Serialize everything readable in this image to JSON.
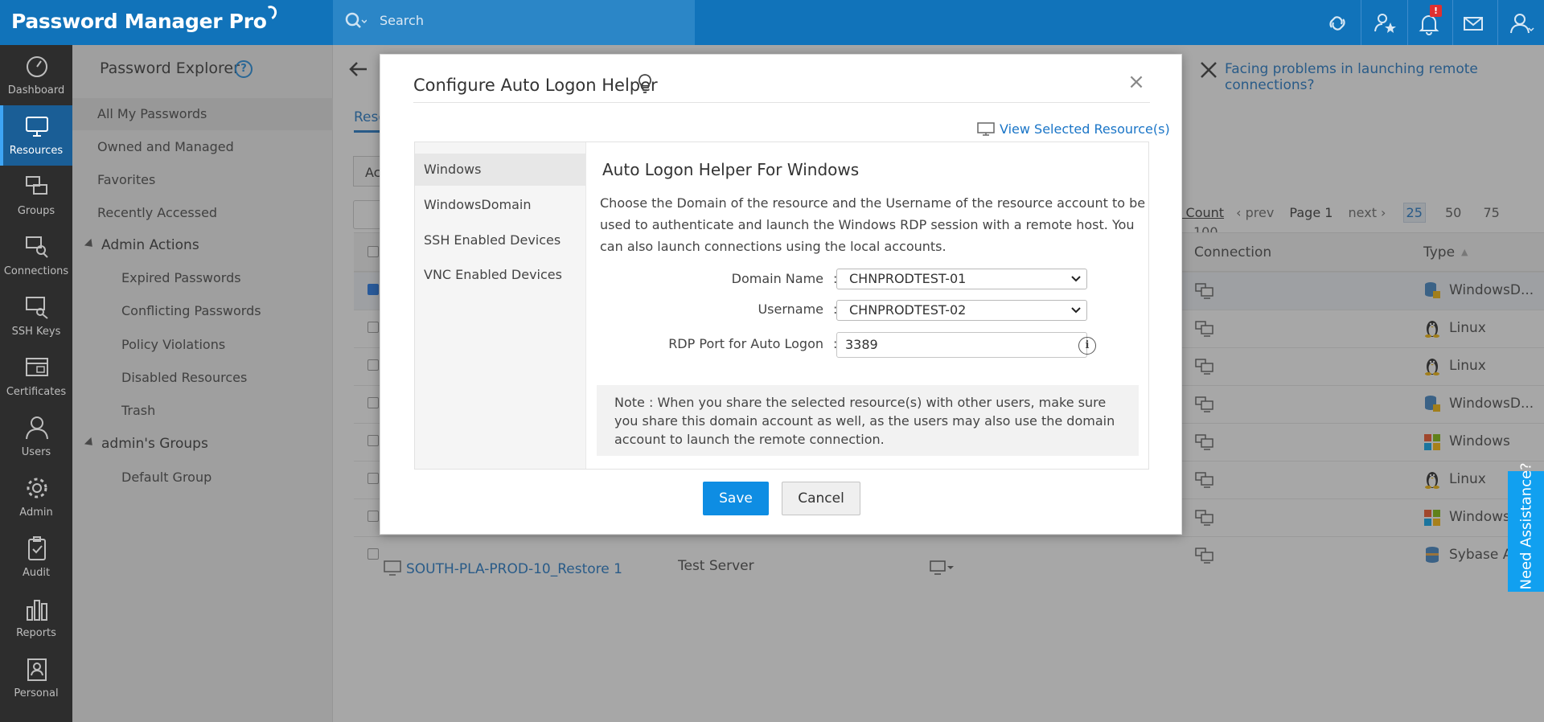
{
  "app": {
    "title": "Password Manager Pro",
    "search_placeholder": "Search",
    "notification_count": "!"
  },
  "leftnav": {
    "items": [
      {
        "label": "Dashboard",
        "icon": "dashboard-icon"
      },
      {
        "label": "Resources",
        "icon": "monitor-icon",
        "active": true
      },
      {
        "label": "Groups",
        "icon": "groups-icon"
      },
      {
        "label": "Connections",
        "icon": "connections-icon"
      },
      {
        "label": "SSH Keys",
        "icon": "ssh-key-icon"
      },
      {
        "label": "Certificates",
        "icon": "certificate-icon"
      },
      {
        "label": "Users",
        "icon": "user-icon"
      },
      {
        "label": "Admin",
        "icon": "gear-icon"
      },
      {
        "label": "Audit",
        "icon": "audit-icon"
      },
      {
        "label": "Reports",
        "icon": "reports-icon"
      },
      {
        "label": "Personal",
        "icon": "personal-icon"
      }
    ]
  },
  "sidepanel": {
    "title": "Password Explorer",
    "help": "?",
    "items": [
      {
        "label": "All My Passwords",
        "active": true
      },
      {
        "label": "Owned and Managed"
      },
      {
        "label": "Favorites"
      },
      {
        "label": "Recently Accessed"
      }
    ],
    "admin_actions": {
      "header": "Admin Actions",
      "items": [
        "Expired Passwords",
        "Conflicting Passwords",
        "Policy Violations",
        "Disabled Resources",
        "Trash"
      ]
    },
    "admin_groups": {
      "header": "admin's Groups",
      "items": [
        "Default Group"
      ]
    }
  },
  "main": {
    "facing_problems": "Facing problems in launching remote connections?",
    "tab_partial": "Reso",
    "actions_partial": "Ac",
    "pager": {
      "total_count": "l Count",
      "prev": "prev",
      "page": "Page 1",
      "next": "next",
      "sizes": [
        "25",
        "50",
        "75",
        "100"
      ],
      "selected_size": "25"
    },
    "columns": {
      "connection": "Connection",
      "type": "Type"
    },
    "rows": [
      {
        "type": "WindowsD...",
        "icon": "windows-domain-icon",
        "checked": true
      },
      {
        "type": "Linux",
        "icon": "linux-icon"
      },
      {
        "type": "Linux",
        "icon": "linux-icon"
      },
      {
        "type": "WindowsD...",
        "icon": "windows-domain-icon"
      },
      {
        "type": "Windows",
        "icon": "windows-icon"
      },
      {
        "type": "Linux",
        "icon": "linux-icon"
      },
      {
        "type": "Windows",
        "icon": "windows-icon"
      },
      {
        "type": "Sybase ASE",
        "icon": "sybase-icon"
      }
    ],
    "last_row": {
      "name": "SOUTH-PLA-PROD-10_Restore 1",
      "description": "Test Server"
    }
  },
  "need_assistance": "Need Assistance?",
  "dialog": {
    "title": "Configure Auto Logon Helper",
    "view_selected": "View Selected Resource(s)",
    "tabs": [
      "Windows",
      "WindowsDomain",
      "SSH Enabled Devices",
      "VNC Enabled Devices"
    ],
    "active_tab": "Windows",
    "heading": "Auto Logon Helper For Windows",
    "description": "Choose the Domain of the resource and the Username of the resource account to be used to authenticate and launch the Windows RDP session with a remote host. You can also launch connections using the local accounts.",
    "fields": {
      "domain_label": "Domain Name",
      "domain_value": "CHNPRODTEST-01",
      "username_label": "Username",
      "username_value": "CHNPRODTEST-02",
      "rdp_label": "RDP Port for Auto Logon",
      "rdp_value": "3389",
      "colon": ":"
    },
    "note": "Note : When you share the selected resource(s) with other users, make sure you share this domain account as well, as the users may also use the domain account to launch the remote connection.",
    "save": "Save",
    "cancel": "Cancel"
  },
  "colors": {
    "topbar": "#1173ba",
    "leftnav": "#2d2d2d",
    "accent": "#0e8de3",
    "link": "#1a75c7",
    "help_tab": "#11a0f0"
  }
}
